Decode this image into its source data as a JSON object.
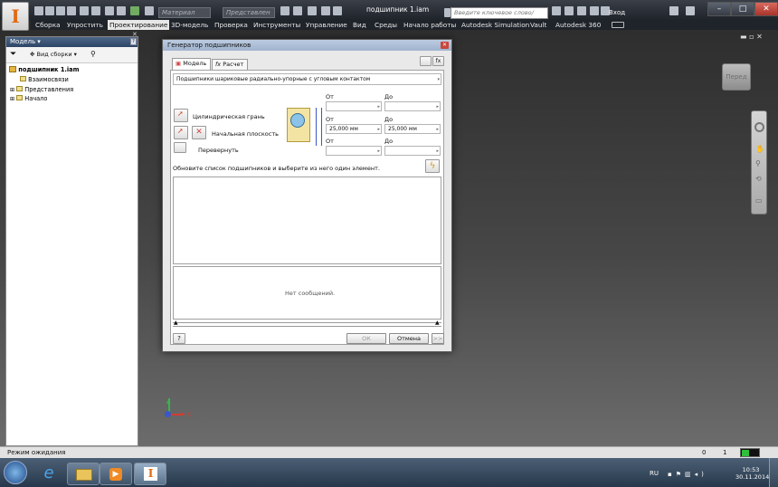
{
  "app": {
    "document_title": "подшипник 1.iam",
    "login_label": "Вход",
    "brand_color": "#e06a13"
  },
  "toolbar": {
    "material_placeholder": "Материал",
    "view_placeholder": "Представлен",
    "search_placeholder": "Введите ключевое слово/фразу"
  },
  "menu": {
    "tabs": [
      "Сборка",
      "Упростить",
      "Проектирование",
      "3D-модель",
      "Проверка",
      "Инструменты",
      "Управление",
      "Вид",
      "Среды",
      "Начало работы",
      "Autodesk Simulation",
      "Vault",
      "Autodesk 360"
    ],
    "active": "Проектирование"
  },
  "browser": {
    "title": "Модель",
    "view_label": "Вид сборки",
    "items": [
      "подшипник 1.iam",
      "Взаимосвязи",
      "Представления",
      "Начало"
    ]
  },
  "viewcube": {
    "label": "Перед"
  },
  "dialog": {
    "title": "Генератор подшипников",
    "tabs": [
      "Модель",
      "Расчет"
    ],
    "bearing_type": "Подшипники шариковые радиально-упорные с угловым контактом",
    "labels": {
      "from1": "От",
      "to1": "До",
      "from2": "От",
      "to2": "До",
      "from3": "От",
      "to3": "До"
    },
    "cyl_face": "Цилиндрическая грань",
    "start_plane": "Начальная плоскость",
    "flip": "Перевернуть",
    "values": {
      "from2": "25,000 мм",
      "to2": "25,000 мм"
    },
    "hint": "Обновите список подшипников и выберите из него один элемент.",
    "messages": "Нет сообщений.",
    "ok": "ОК",
    "cancel": "Отмена",
    "more": ">>"
  },
  "axes": {
    "x": "X"
  },
  "status": {
    "text": "Режим ожидания",
    "count1": "0",
    "count2": "1"
  },
  "taskbar": {
    "lang": "RU",
    "time": "10:53",
    "date": "30.11.2014"
  }
}
